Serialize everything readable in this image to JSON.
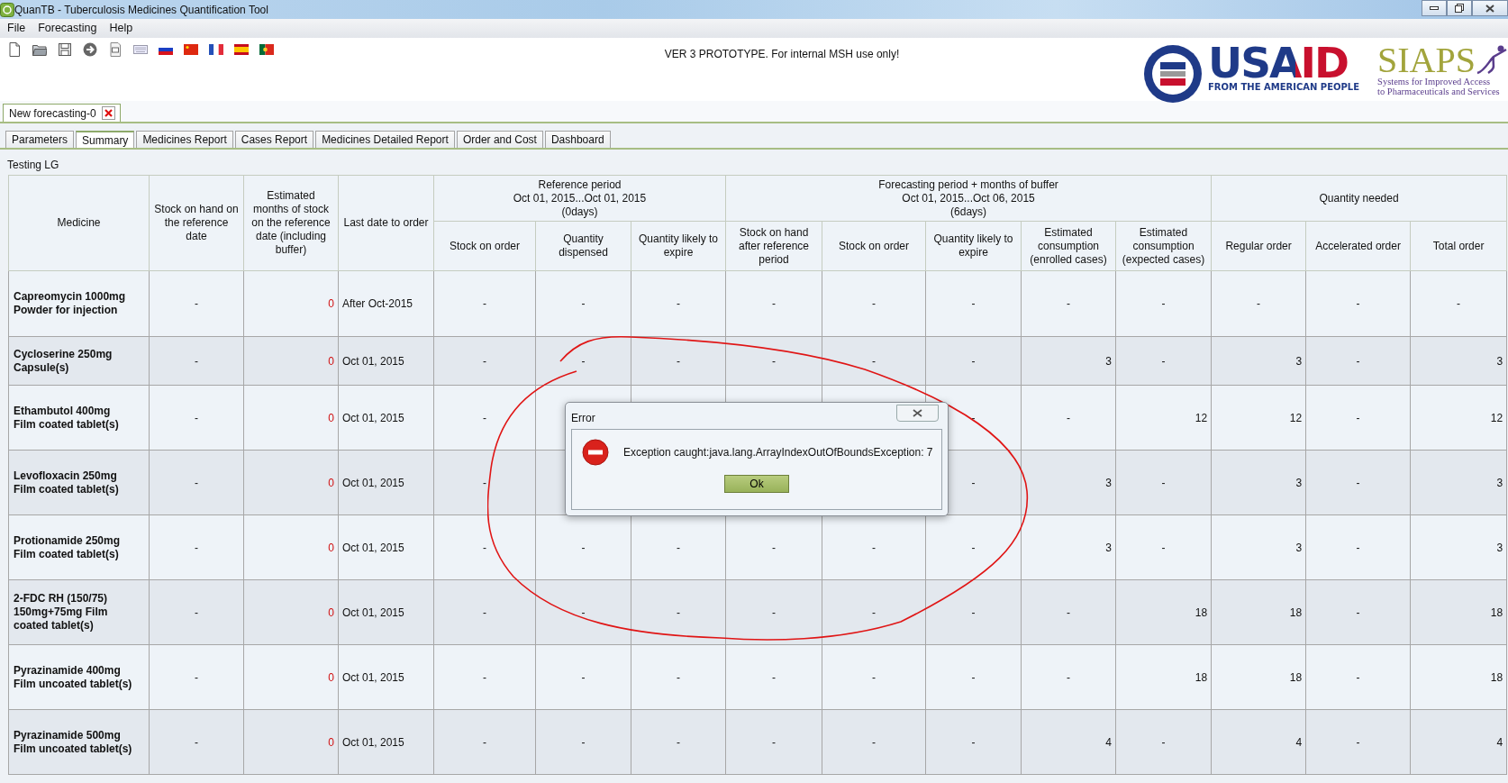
{
  "window": {
    "title": "QuanTB - Tuberculosis Medicines Quantification Tool"
  },
  "menu": [
    "File",
    "Forecasting",
    "Help"
  ],
  "toolbar": {
    "notice": "VER 3 PROTOTYPE. For internal MSH use only!"
  },
  "logos": {
    "usaid": "USAID",
    "usaid_tagline": "FROM THE AMERICAN PEOPLE",
    "siaps": "SIAPS",
    "siaps_tagline": [
      "Systems for Improved Access",
      "to Pharmaceuticals and Services"
    ]
  },
  "document_tabs": [
    {
      "label": "New forecasting-0",
      "selected": true
    }
  ],
  "tabs": [
    {
      "label": "Parameters",
      "selected": false
    },
    {
      "label": "Summary",
      "selected": true
    },
    {
      "label": "Medicines Report",
      "selected": false
    },
    {
      "label": "Cases Report",
      "selected": false
    },
    {
      "label": "Medicines Detailed Report",
      "selected": false
    },
    {
      "label": "Order and Cost",
      "selected": false
    },
    {
      "label": "Dashboard",
      "selected": false
    }
  ],
  "report_title": "Testing LG",
  "table": {
    "header_groups": [
      {
        "label": "Medicine",
        "kind": "medicine"
      },
      {
        "label": "Stock on hand on the reference date",
        "kind": "number"
      },
      {
        "label": "Estimated months of stock on the reference date (including buffer)",
        "kind": "months"
      },
      {
        "label": "Last date to order",
        "kind": "date"
      },
      {
        "lines": [
          "Reference period",
          "Oct 01, 2015...Oct 01, 2015",
          "(0days)"
        ],
        "columns": [
          "Stock on order",
          "Quantity dispensed",
          "Quantity likely to expire"
        ]
      },
      {
        "lines": [
          "Forecasting period + months of buffer",
          "Oct 01, 2015...Oct 06, 2015",
          "(6days)"
        ],
        "columns": [
          "Stock on hand after reference period",
          "Stock on order",
          "Quantity likely to expire",
          "Estimated consumption (enrolled cases)",
          "Estimated consumption (expected cases)"
        ]
      },
      {
        "lines": [
          "Quantity needed"
        ],
        "columns": [
          "Regular order",
          "Accelerated order",
          "Total order"
        ]
      }
    ],
    "rows": [
      {
        "medicine": "Capreomycin 1000mg\nPowder for injection",
        "cells": [
          "-",
          "0",
          "After Oct-2015",
          "-",
          "-",
          "-",
          "-",
          "-",
          "-",
          "-",
          "-",
          "-",
          "-",
          "-"
        ]
      },
      {
        "medicine": "Cycloserine 250mg\nCapsule(s)",
        "cells": [
          "-",
          "0",
          "Oct 01, 2015",
          "-",
          "-",
          "-",
          "-",
          "-",
          "-",
          "3",
          "-",
          "3",
          "-",
          "3"
        ]
      },
      {
        "medicine": "Ethambutol 400mg\nFilm coated tablet(s)",
        "cells": [
          "-",
          "0",
          "Oct 01, 2015",
          "-",
          null,
          null,
          null,
          null,
          "-",
          "-",
          "12",
          "12",
          "-",
          "12"
        ]
      },
      {
        "medicine": "Levofloxacin 250mg\nFilm coated tablet(s)",
        "cells": [
          "-",
          "0",
          "Oct 01, 2015",
          "-",
          null,
          null,
          null,
          null,
          "-",
          "3",
          "-",
          "3",
          "-",
          "3"
        ]
      },
      {
        "medicine": "Protionamide 250mg\nFilm coated tablet(s)",
        "cells": [
          "-",
          "0",
          "Oct 01, 2015",
          "-",
          "-",
          "-",
          "-",
          "-",
          "-",
          "3",
          "-",
          "3",
          "-",
          "3"
        ]
      },
      {
        "medicine": "2-FDC RH (150/75)\n150mg+75mg Film\ncoated tablet(s)",
        "cells": [
          "-",
          "0",
          "Oct 01, 2015",
          "-",
          "-",
          "-",
          "-",
          "-",
          "-",
          "-",
          "18",
          "18",
          "-",
          "18"
        ]
      },
      {
        "medicine": "Pyrazinamide 400mg\nFilm uncoated tablet(s)",
        "cells": [
          "-",
          "0",
          "Oct 01, 2015",
          "-",
          "-",
          "-",
          "-",
          "-",
          "-",
          "-",
          "18",
          "18",
          "-",
          "18"
        ]
      },
      {
        "medicine": "Pyrazinamide 500mg\nFilm uncoated tablet(s)",
        "cells": [
          "-",
          "0",
          "Oct 01, 2015",
          "-",
          "-",
          "-",
          "-",
          "-",
          "-",
          "4",
          "-",
          "4",
          "-",
          "4"
        ]
      }
    ]
  },
  "dialog": {
    "title": "Error",
    "message": "Exception caught:java.lang.ArrayIndexOutOfBoundsException: 7",
    "button": "Ok"
  }
}
